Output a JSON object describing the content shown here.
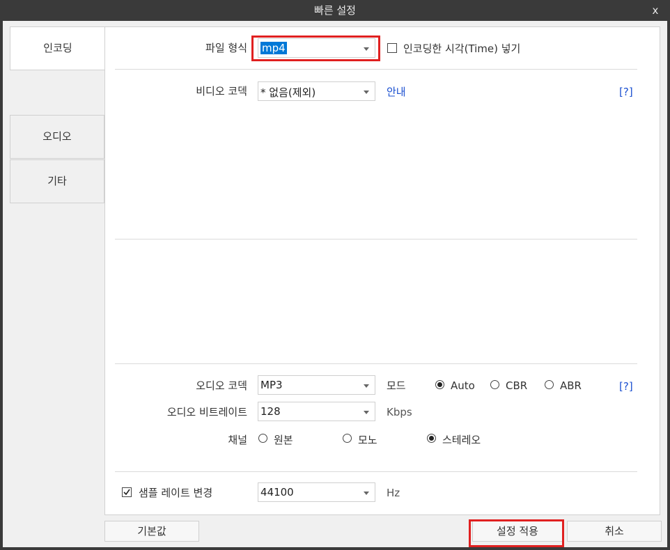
{
  "window": {
    "title": "빠른 설정",
    "close_label": "x"
  },
  "tabs": [
    {
      "label": "인코딩"
    },
    {
      "label": "오디오"
    },
    {
      "label": "기타"
    }
  ],
  "file_format": {
    "label": "파일 형식",
    "value": "mp4",
    "insert_time_label": "인코딩한 시각(Time) 넣기",
    "insert_time_checked": false
  },
  "video": {
    "label": "비디오 코덱",
    "value": "* 없음(제외)",
    "guide_link": "안내",
    "help": "[?]"
  },
  "audio": {
    "codec_label": "오디오 코덱",
    "codec_value": "MP3",
    "mode_label": "모드",
    "modes": [
      {
        "label": "Auto",
        "selected": true
      },
      {
        "label": "CBR",
        "selected": false
      },
      {
        "label": "ABR",
        "selected": false
      }
    ],
    "help": "[?]",
    "bitrate_label": "오디오 비트레이트",
    "bitrate_value": "128",
    "bitrate_unit": "Kbps",
    "channel_label": "채널",
    "channels": [
      {
        "label": "원본",
        "selected": false
      },
      {
        "label": "모노",
        "selected": false
      },
      {
        "label": "스테레오",
        "selected": true
      }
    ]
  },
  "sample_rate": {
    "label": "샘플 레이트 변경",
    "checked": true,
    "value": "44100",
    "unit": "Hz"
  },
  "buttons": {
    "default": "기본값",
    "apply": "설정 적용",
    "cancel": "취소"
  },
  "highlight_color": "#e02020"
}
